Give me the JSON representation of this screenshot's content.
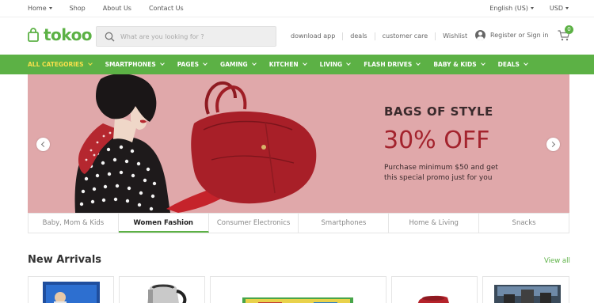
{
  "topbar": {
    "links": [
      "Home",
      "Shop",
      "About Us",
      "Contact Us"
    ],
    "language": "English (US)",
    "currency": "USD"
  },
  "header": {
    "logo": "tokoo",
    "search_placeholder": "What are you looking for ?",
    "links": [
      "download app",
      "deals",
      "customer care",
      "Wishlist"
    ],
    "account_label": "Register or Sign in",
    "cart_count": "0"
  },
  "nav": {
    "items": [
      "ALL CATEGORIES",
      "SMARTPHONES",
      "PAGES",
      "GAMING",
      "KITCHEN",
      "LIVING",
      "FLASH DRIVES",
      "BABY & KIDS",
      "DEALS"
    ],
    "active_color": "#f6e04b"
  },
  "hero": {
    "heading": "BAGS OF STYLE",
    "offer": "30% OFF",
    "description": "Purchase minimum $50 and get this special promo just for you",
    "background": "#e0a8aa"
  },
  "categories": {
    "tabs": [
      "Baby, Mom & Kids",
      "Women Fashion",
      "Consumer Electronics",
      "Smartphones",
      "Home & Living",
      "Snacks"
    ],
    "active_index": 1
  },
  "new_arrivals": {
    "title": "New Arrivals",
    "view_all": "View all"
  },
  "colors": {
    "brand_green": "#5cb145",
    "offer_red": "#a3232d"
  }
}
